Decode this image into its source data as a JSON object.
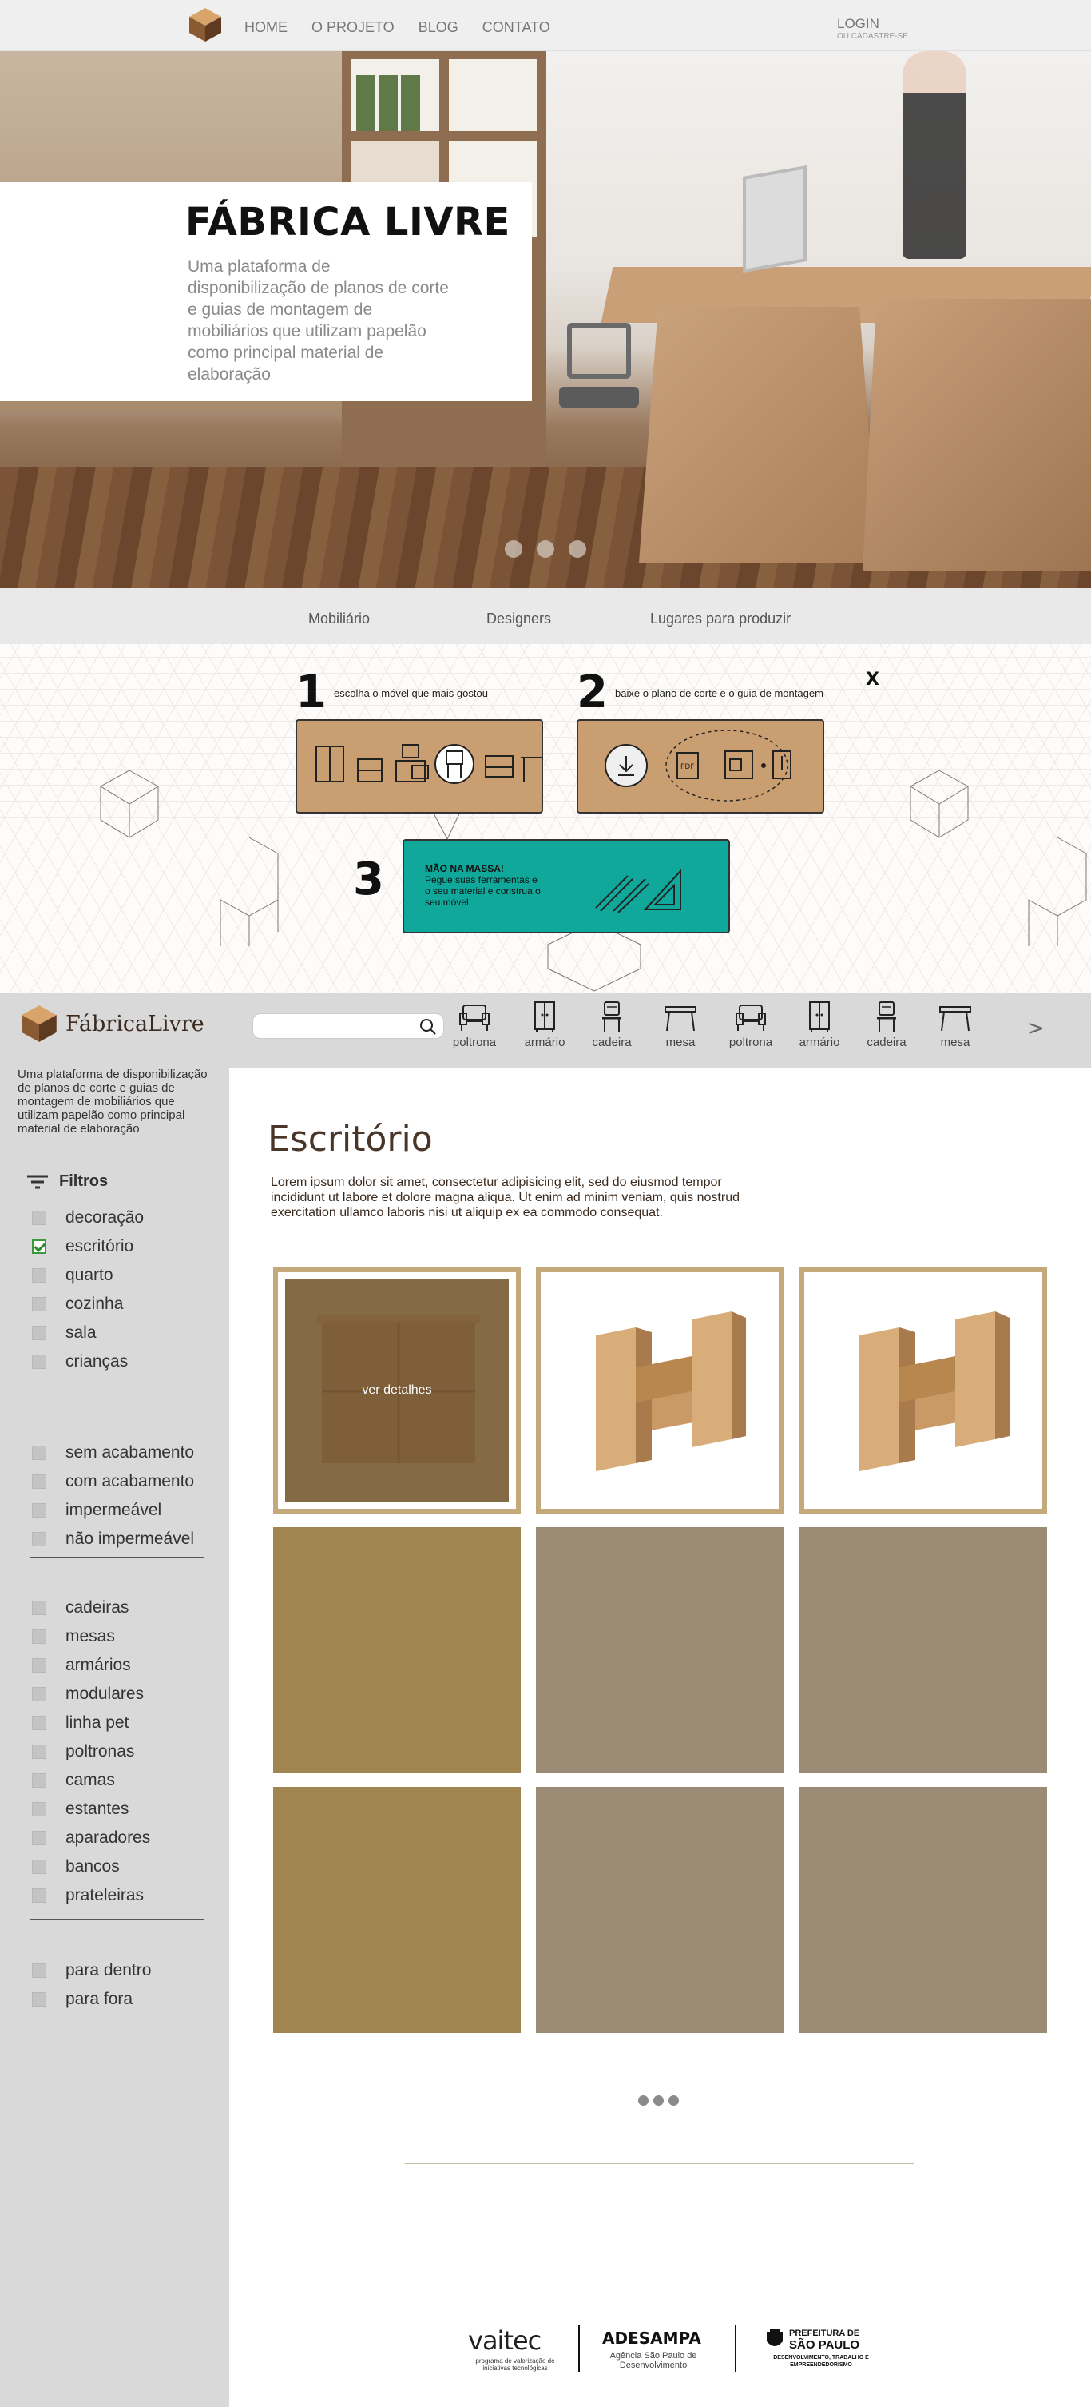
{
  "topnav": {
    "menu": [
      "HOME",
      "O PROJETO",
      "BLOG",
      "CONTATO"
    ],
    "login": "LOGIN",
    "register": "OU CADASTRE-SE"
  },
  "hero": {
    "title": "FÁBRICA LIVRE",
    "subtitle": "Uma plataforma de disponibilização de planos de corte e guias de montagem de mobiliários que utilizam papelão como principal material de elaboração",
    "slides": 3
  },
  "categories": [
    "Mobiliário",
    "Designers",
    "Lugares para produzir"
  ],
  "steps": {
    "close": "X",
    "step1": {
      "num": "1",
      "caption": "escolha o móvel que mais gostou"
    },
    "step2": {
      "num": "2",
      "caption": "baixe o plano de corte e o guia de montagem"
    },
    "step3": {
      "num": "3",
      "title": "MÃO NA MASSA!",
      "text": "Pegue suas ferramentas e o seu material e construa o seu móvel"
    }
  },
  "catalog": {
    "brand": "FábricaLivre",
    "tagline": "Uma plataforma de disponibilização de planos de corte e guias de montagem de mobiliários que utilizam papelão como principal material de elaboração",
    "search_value": "",
    "furniture": [
      {
        "label": "poltrona",
        "icon": "armchair-icon"
      },
      {
        "label": "armário",
        "icon": "wardrobe-icon"
      },
      {
        "label": "cadeira",
        "icon": "chair-icon"
      },
      {
        "label": "mesa",
        "icon": "table-icon"
      },
      {
        "label": "poltrona",
        "icon": "armchair-icon"
      },
      {
        "label": "armário",
        "icon": "wardrobe-icon"
      },
      {
        "label": "cadeira",
        "icon": "chair-icon"
      },
      {
        "label": "mesa",
        "icon": "table-icon"
      }
    ],
    "next_arrow": ">",
    "filters_title": "Filtros",
    "filter_groups": [
      [
        {
          "label": "decoração",
          "checked": false
        },
        {
          "label": "escritório",
          "checked": true
        },
        {
          "label": "quarto",
          "checked": false
        },
        {
          "label": "cozinha",
          "checked": false
        },
        {
          "label": "sala",
          "checked": false
        },
        {
          "label": "crianças",
          "checked": false
        }
      ],
      [
        {
          "label": "sem acabamento",
          "checked": false
        },
        {
          "label": "com acabamento",
          "checked": false
        },
        {
          "label": "impermeável",
          "checked": false
        },
        {
          "label": "não impermeável",
          "checked": false
        }
      ],
      [
        {
          "label": "cadeiras",
          "checked": false
        },
        {
          "label": "mesas",
          "checked": false
        },
        {
          "label": "armários",
          "checked": false
        },
        {
          "label": "modulares",
          "checked": false
        },
        {
          "label": "linha pet",
          "checked": false
        },
        {
          "label": "poltronas",
          "checked": false
        },
        {
          "label": "camas",
          "checked": false
        },
        {
          "label": "estantes",
          "checked": false
        },
        {
          "label": "aparadores",
          "checked": false
        },
        {
          "label": "bancos",
          "checked": false
        },
        {
          "label": "prateleiras",
          "checked": false
        }
      ],
      [
        {
          "label": "para dentro",
          "checked": false
        },
        {
          "label": "para fora",
          "checked": false
        }
      ]
    ],
    "section_title": "Escritório",
    "section_desc": "Lorem ipsum dolor sit amet, consectetur adipisicing elit, sed do eiusmod tempor incididunt ut labore et dolore magna aliqua. Ut enim ad minim veniam, quis nostrud exercitation ullamco laboris nisi ut aliquip ex ea commodo consequat.",
    "hover_label": "ver detalhes",
    "colors": {
      "frame": "#c4a97a",
      "gold": "#a08551",
      "grey": "#9b8a74",
      "teal": "#0fa89b",
      "kraft": "#c99f72"
    }
  },
  "footer": {
    "vaitec": "vaitec",
    "vaitec_sub": "programa de valorização de iniciativas tecnológicas",
    "adesampa": "ADESAMPA",
    "adesampa_sub": "Agência São Paulo de Desenvolvimento",
    "pref_1": "PREFEITURA DE",
    "pref_2": "SÃO PAULO",
    "pref_3": "DESENVOLVIMENTO, TRABALHO E EMPREENDEDORISMO"
  }
}
